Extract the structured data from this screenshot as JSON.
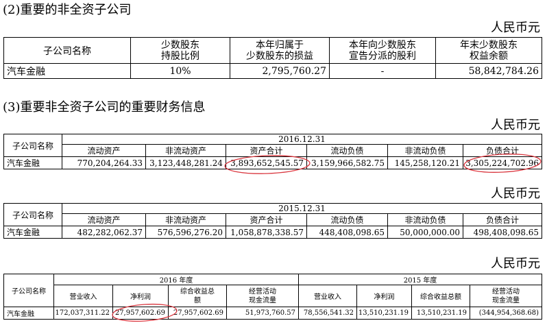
{
  "section2": {
    "heading": "(2)重要的非全资子公司",
    "unit": "人民币元",
    "headers": {
      "name": "子公司名称",
      "ratio_l1": "少数股东",
      "ratio_l2": "持股比例",
      "pl_l1": "本年归属于",
      "pl_l2": "少数股东的损益",
      "div_l1": "本年向少数股东",
      "div_l2": "宣告分派的股利",
      "eq_l1": "年末少数股东",
      "eq_l2": "权益余额"
    },
    "row": {
      "name": "汽车金融",
      "ratio": "10%",
      "pl": "2,795,760.27",
      "div": "-",
      "eq": "58,842,784.26"
    }
  },
  "section3": {
    "heading": "(3)重要非全资子公司的重要财务信息",
    "unit": "人民币元",
    "col_name": "子公司名称",
    "bs_headers": [
      "流动资产",
      "非流动资产",
      "资产合计",
      "流动负债",
      "非流动负债",
      "负债合计"
    ],
    "bs2016": {
      "date": "2016.12.31",
      "row": {
        "name": "汽车金融",
        "values": [
          "770,204,264.33",
          "3,123,448,281.24",
          "3,893,652,545.57",
          "3,159,966,582.75",
          "145,258,120.21",
          "3,305,224,702.96"
        ]
      }
    },
    "unit2": "人民币元",
    "bs2015": {
      "date": "2015.12.31",
      "row": {
        "name": "汽车金融",
        "values": [
          "482,282,062.37",
          "576,596,276.20",
          "1,058,878,338.57",
          "448,408,098.65",
          "50,000,000.00",
          "498,408,098.65"
        ]
      }
    },
    "unit3": "人民币元",
    "pl": {
      "year2016": "2016 年度",
      "year2015": "2015 年度",
      "h_revenue": "营业收入",
      "h_netprofit": "净利润",
      "h_ci_l1": "综合收益总",
      "h_ci_l2": "额",
      "h_ci_2015": "综合收益总额",
      "h_cf_l1": "经营活动",
      "h_cf_l2": "现金流量",
      "row": {
        "name": "汽车金融",
        "values": [
          "172,037,311.22",
          "27,957,602.69",
          "27,957,602.69",
          "51,973,760.57",
          "78,556,541.32",
          "13,510,231.19",
          "13,510,231.19",
          "(344,954,368.68)"
        ]
      }
    }
  },
  "annotation_color": "#d9363e"
}
